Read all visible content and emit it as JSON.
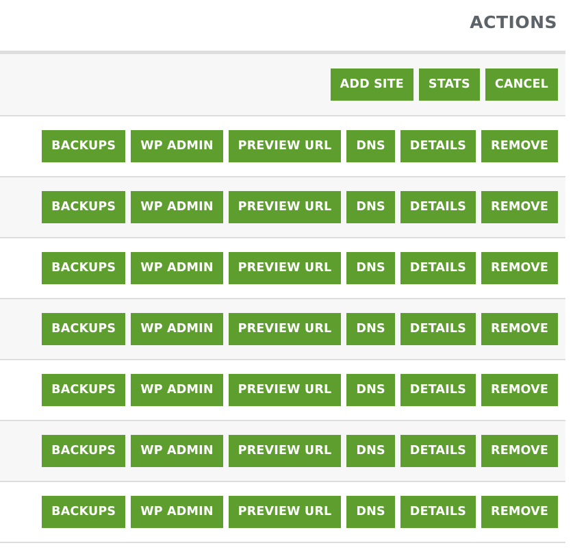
{
  "header": {
    "title": "ACTIONS"
  },
  "toolbar": {
    "buttons": [
      {
        "label": "ADD SITE"
      },
      {
        "label": "STATS"
      },
      {
        "label": "CANCEL"
      }
    ]
  },
  "button_color": "#5d9e2f",
  "row_actions": [
    "BACKUPS",
    "WP ADMIN",
    "PREVIEW URL",
    "DNS",
    "DETAILS",
    "REMOVE"
  ],
  "rows": [
    {
      "actions": [
        "BACKUPS",
        "WP ADMIN",
        "PREVIEW URL",
        "DNS",
        "DETAILS",
        "REMOVE"
      ]
    },
    {
      "actions": [
        "BACKUPS",
        "WP ADMIN",
        "PREVIEW URL",
        "DNS",
        "DETAILS",
        "REMOVE"
      ]
    },
    {
      "actions": [
        "BACKUPS",
        "WP ADMIN",
        "PREVIEW URL",
        "DNS",
        "DETAILS",
        "REMOVE"
      ]
    },
    {
      "actions": [
        "BACKUPS",
        "WP ADMIN",
        "PREVIEW URL",
        "DNS",
        "DETAILS",
        "REMOVE"
      ]
    },
    {
      "actions": [
        "BACKUPS",
        "WP ADMIN",
        "PREVIEW URL",
        "DNS",
        "DETAILS",
        "REMOVE"
      ]
    },
    {
      "actions": [
        "BACKUPS",
        "WP ADMIN",
        "PREVIEW URL",
        "DNS",
        "DETAILS",
        "REMOVE"
      ]
    },
    {
      "actions": [
        "BACKUPS",
        "WP ADMIN",
        "PREVIEW URL",
        "DNS",
        "DETAILS",
        "REMOVE"
      ]
    }
  ]
}
